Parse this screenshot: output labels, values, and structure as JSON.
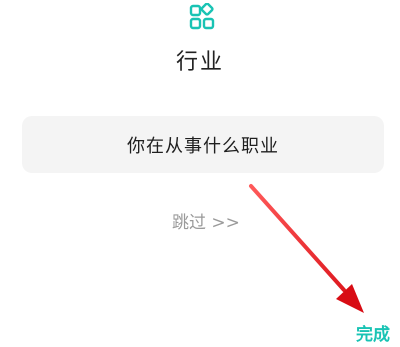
{
  "header": {
    "icon": "grid-shapes-icon",
    "title": "行业"
  },
  "occupation": {
    "prompt": "你在从事什么职业"
  },
  "skip": {
    "label": "跳过 >>"
  },
  "footer": {
    "done_label": "完成"
  },
  "colors": {
    "accent": "#19c3b4",
    "field_bg": "#f4f4f4",
    "muted_text": "#9a9a9a",
    "annotation_arrow": "#e0161e"
  }
}
